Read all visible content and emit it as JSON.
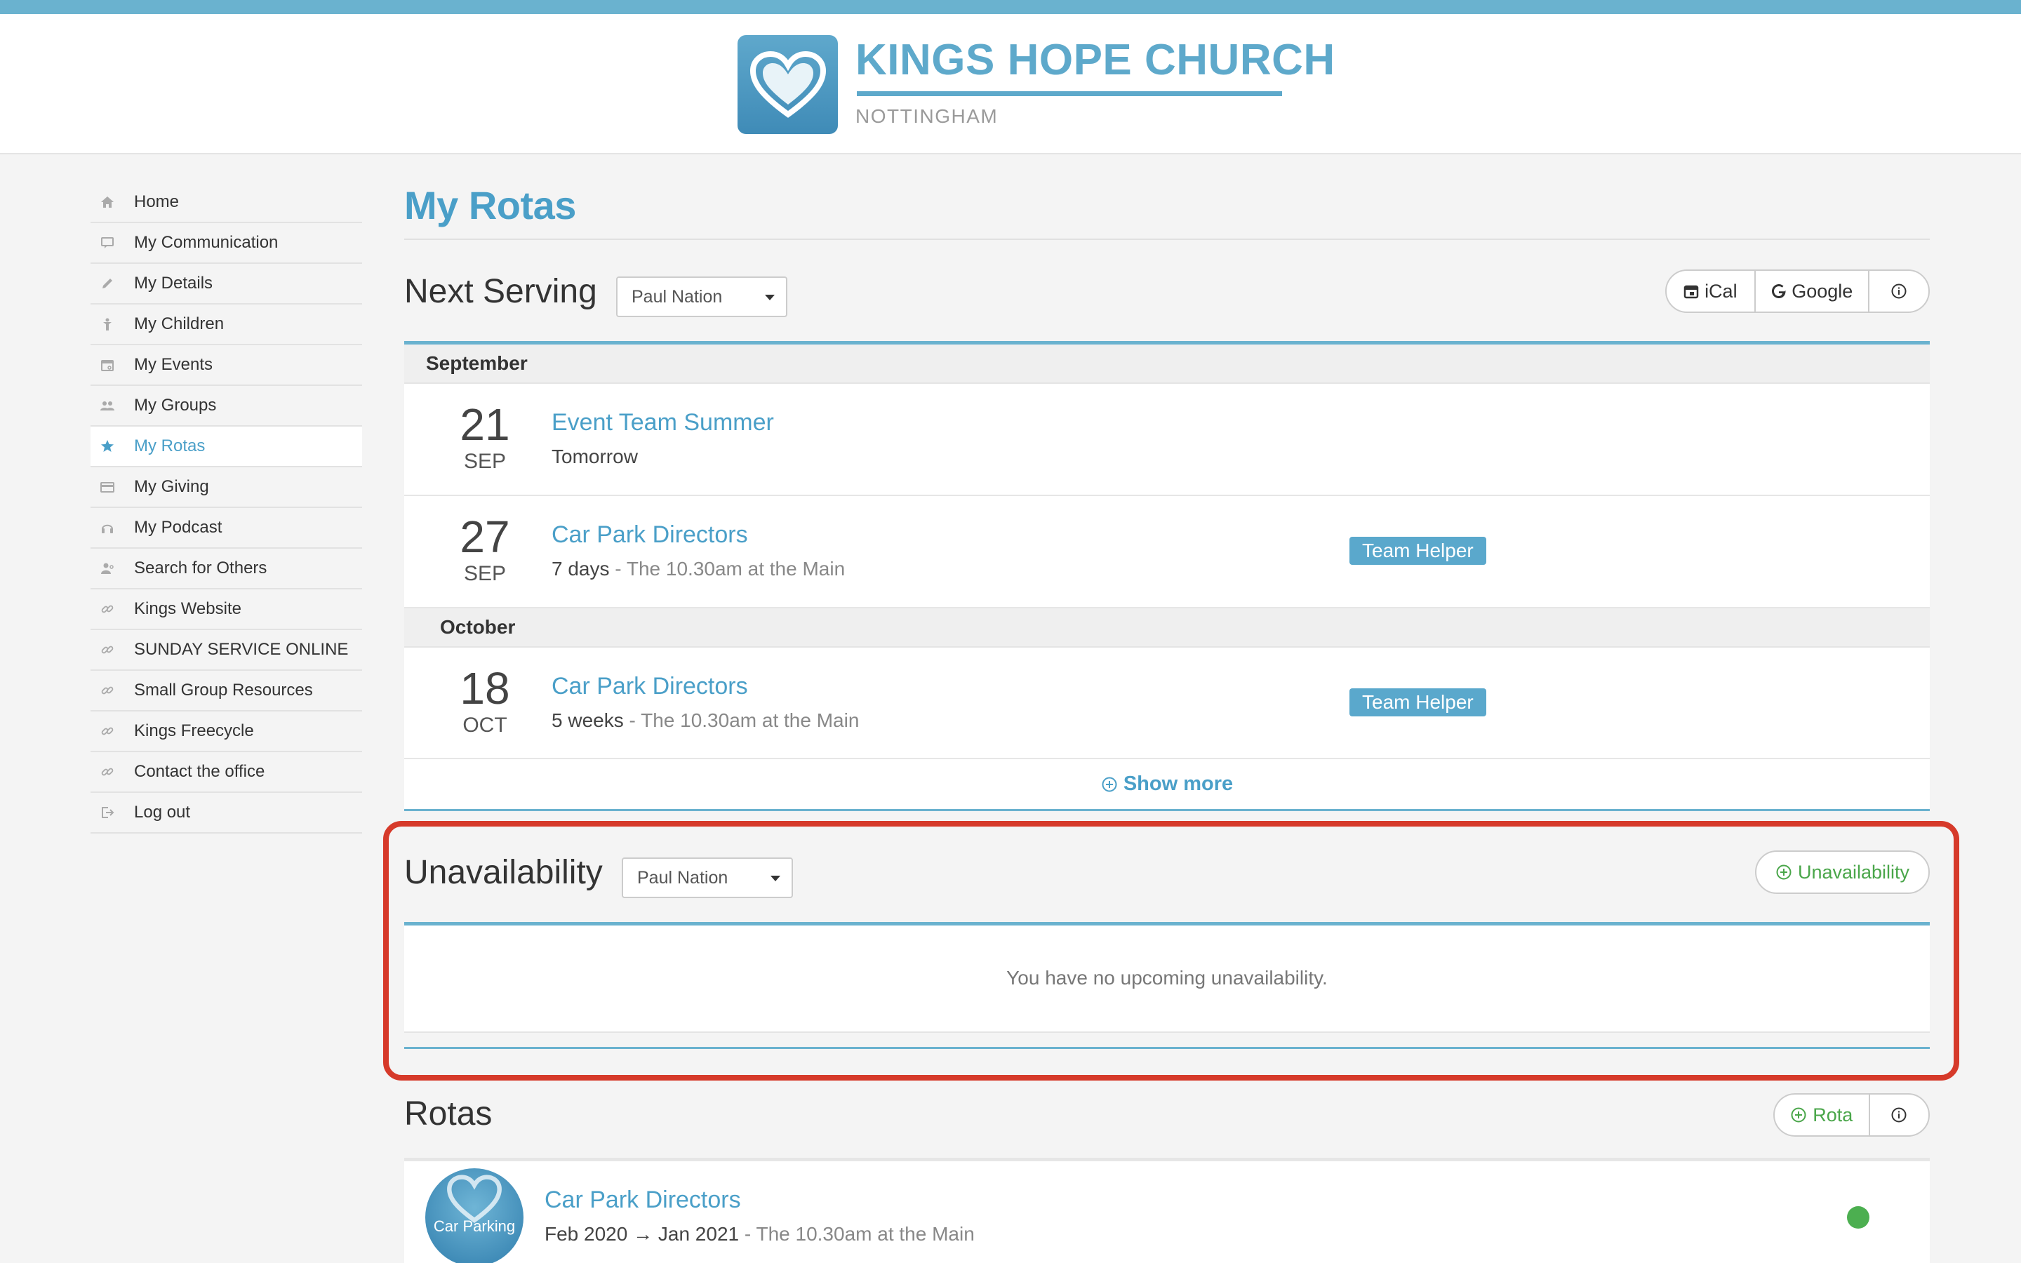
{
  "header": {
    "church_name": "KINGS HOPE CHURCH",
    "location": "NOTTINGHAM"
  },
  "sidebar": {
    "items": [
      {
        "label": "Home",
        "icon": "home-icon"
      },
      {
        "label": "My Communication",
        "icon": "comment-icon"
      },
      {
        "label": "My Details",
        "icon": "pencil-icon"
      },
      {
        "label": "My Children",
        "icon": "child-icon"
      },
      {
        "label": "My Events",
        "icon": "calendar-icon"
      },
      {
        "label": "My Groups",
        "icon": "users-icon"
      },
      {
        "label": "My Rotas",
        "icon": "star-icon"
      },
      {
        "label": "My Giving",
        "icon": "credit-card-icon"
      },
      {
        "label": "My Podcast",
        "icon": "headphones-icon"
      },
      {
        "label": "Search for Others",
        "icon": "user-search-icon"
      },
      {
        "label": "Kings Website",
        "icon": "link-icon"
      },
      {
        "label": "SUNDAY SERVICE ONLINE",
        "icon": "link-icon"
      },
      {
        "label": "Small Group Resources",
        "icon": "link-icon"
      },
      {
        "label": "Kings Freecycle",
        "icon": "link-icon"
      },
      {
        "label": "Contact the office",
        "icon": "link-icon"
      },
      {
        "label": "Log out",
        "icon": "logout-icon"
      }
    ],
    "active_index": 6
  },
  "page": {
    "title": "My Rotas"
  },
  "next_serving": {
    "title": "Next Serving",
    "person_select": "Paul Nation",
    "ical_label": "iCal",
    "google_label": "Google",
    "months": [
      {
        "label": "September"
      },
      {
        "label": "October"
      }
    ],
    "events": [
      {
        "day": "21",
        "month": "SEP",
        "name": "Event Team Summer",
        "when": "Tomorrow",
        "location": "",
        "badge": ""
      },
      {
        "day": "27",
        "month": "SEP",
        "name": "Car Park Directors",
        "when": "7 days",
        "location": " - The 10.30am at the Main",
        "badge": "Team Helper"
      },
      {
        "day": "18",
        "month": "OCT",
        "name": "Car Park Directors",
        "when": "5 weeks",
        "location": " - The 10.30am at the Main",
        "badge": "Team Helper"
      }
    ],
    "show_more": "Show more"
  },
  "unavailability": {
    "title": "Unavailability",
    "person_select": "Paul Nation",
    "add_label": "Unavailability",
    "empty_message": "You have no upcoming unavailability."
  },
  "rotas": {
    "title": "Rotas",
    "add_label": "Rota",
    "items": [
      {
        "avatar_text": "Car Parking",
        "name": "Car Park Directors",
        "dates": "Feb 2020 → Jan 2021",
        "location": " - The 10.30am at the Main",
        "status_color": "#4caf50"
      }
    ]
  },
  "colors": {
    "accent": "#4a9fc8",
    "topbar": "#6ab2cf",
    "highlight": "#d63a2a",
    "add_green": "#4aa64a"
  }
}
